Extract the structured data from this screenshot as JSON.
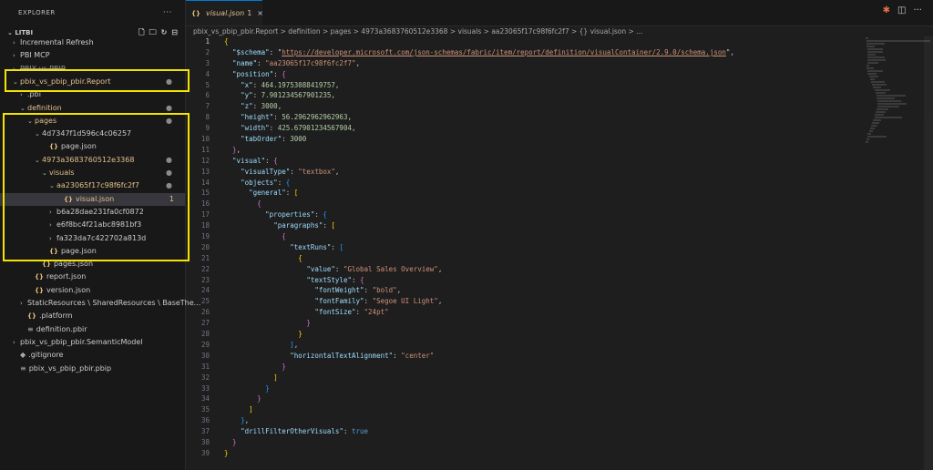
{
  "sidebar": {
    "title": "EXPLORER",
    "more": "···",
    "workspace": "LITBI",
    "tree": [
      {
        "label": "Incremental Refresh",
        "depth": 1,
        "chevron": "right",
        "icon": "",
        "mod": false
      },
      {
        "label": "PBI MCP",
        "depth": 1,
        "chevron": "right",
        "icon": "",
        "mod": false
      },
      {
        "label": "PBIX vs PBIP",
        "depth": 1,
        "chevron": "right",
        "icon": "",
        "mod": false,
        "strike": true
      },
      {
        "label": "pbix_vs_pbip_pbir.Report",
        "depth": 1,
        "chevron": "down",
        "icon": "",
        "mod": true,
        "dot": true
      },
      {
        "label": ".pbi",
        "depth": 2,
        "chevron": "right",
        "icon": "",
        "mod": false
      },
      {
        "label": "definition",
        "depth": 2,
        "chevron": "down",
        "icon": "",
        "mod": true,
        "dot": true
      },
      {
        "label": "pages",
        "depth": 3,
        "chevron": "down",
        "icon": "",
        "mod": true,
        "dot": true
      },
      {
        "label": "4d7347f1d596c4c06257",
        "depth": 4,
        "chevron": "down",
        "icon": "",
        "mod": false
      },
      {
        "label": "page.json",
        "depth": 5,
        "chevron": "",
        "icon": "json",
        "mod": false
      },
      {
        "label": "4973a3683760512e3368",
        "depth": 4,
        "chevron": "down",
        "icon": "",
        "mod": true,
        "dot": true
      },
      {
        "label": "visuals",
        "depth": 5,
        "chevron": "down",
        "icon": "",
        "mod": true,
        "dot": true
      },
      {
        "label": "aa23065f17c98f6fc2f7",
        "depth": 6,
        "chevron": "down",
        "icon": "",
        "mod": true,
        "dot": true
      },
      {
        "label": "visual.json",
        "depth": 7,
        "chevron": "",
        "icon": "json",
        "mod": true,
        "badge": "1",
        "active": true
      },
      {
        "label": "b6a28dae231fa0cf0872",
        "depth": 6,
        "chevron": "right",
        "icon": "",
        "mod": false
      },
      {
        "label": "e6f8bc4f21abc8981bf3",
        "depth": 6,
        "chevron": "right",
        "icon": "",
        "mod": false
      },
      {
        "label": "fa323da7c422702a813d",
        "depth": 6,
        "chevron": "right",
        "icon": "",
        "mod": false
      },
      {
        "label": "page.json",
        "depth": 5,
        "chevron": "",
        "icon": "json",
        "mod": false
      },
      {
        "label": "pages.json",
        "depth": 4,
        "chevron": "",
        "icon": "json",
        "mod": false
      },
      {
        "label": "report.json",
        "depth": 3,
        "chevron": "",
        "icon": "json",
        "mod": false
      },
      {
        "label": "version.json",
        "depth": 3,
        "chevron": "",
        "icon": "json",
        "mod": false
      },
      {
        "label": "StaticResources \\ SharedResources \\ BaseThe...",
        "depth": 2,
        "chevron": "right",
        "icon": "",
        "mod": false
      },
      {
        "label": ".platform",
        "depth": 2,
        "chevron": "",
        "icon": "json",
        "mod": false
      },
      {
        "label": "definition.pbir",
        "depth": 2,
        "chevron": "",
        "icon": "file",
        "mod": false
      },
      {
        "label": "pbix_vs_pbip_pbir.SemanticModel",
        "depth": 1,
        "chevron": "right",
        "icon": "",
        "mod": false
      },
      {
        "label": ".gitignore",
        "depth": 1,
        "chevron": "",
        "icon": "git",
        "mod": false
      },
      {
        "label": "pbix_vs_pbip_pbir.pbip",
        "depth": 1,
        "chevron": "",
        "icon": "file",
        "mod": false
      }
    ]
  },
  "tab": {
    "icon": "{}",
    "title": "visual.json",
    "badge": "1",
    "close": "×"
  },
  "breadcrumb": "pbix_vs_pbip_pbir.Report  >  definition  >  pages  >  4973a3683760512e3368  >  visuals  >  aa23065f17c98f6fc2f7  >  {}  visual.json  >  ...",
  "code": [
    "{",
    "  \"$schema\": \"https://developer.microsoft.com/json-schemas/fabric/item/report/definition/visualContainer/2.9.0/schema.json\",",
    "  \"name\": \"aa23065f17c98f6fc2f7\",",
    "  \"position\": {",
    "    \"x\": 464.19753088419757,",
    "    \"y\": 7.901234567901235,",
    "    \"z\": 3000,",
    "    \"height\": 56.2962962962963,",
    "    \"width\": 425.67901234567904,",
    "    \"tabOrder\": 3000",
    "  },",
    "  \"visual\": {",
    "    \"visualType\": \"textbox\",",
    "    \"objects\": {",
    "      \"general\": [",
    "        {",
    "          \"properties\": {",
    "            \"paragraphs\": [",
    "              {",
    "                \"textRuns\": [",
    "                  {",
    "                    \"value\": \"Global Sales Overview\",",
    "                    \"textStyle\": {",
    "                      \"fontWeight\": \"bold\",",
    "                      \"fontFamily\": \"Segoe UI Light\",",
    "                      \"fontSize\": \"24pt\"",
    "                    }",
    "                  }",
    "                ],",
    "                \"horizontalTextAlignment\": \"center\"",
    "              }",
    "            ]",
    "          }",
    "        }",
    "      ]",
    "    },",
    "    \"drillFilterOtherVisuals\": true",
    "  }",
    "}"
  ],
  "colors": {
    "highlight": "#f5e400",
    "modified": "#e2c08d",
    "accent": "#0078d4"
  }
}
